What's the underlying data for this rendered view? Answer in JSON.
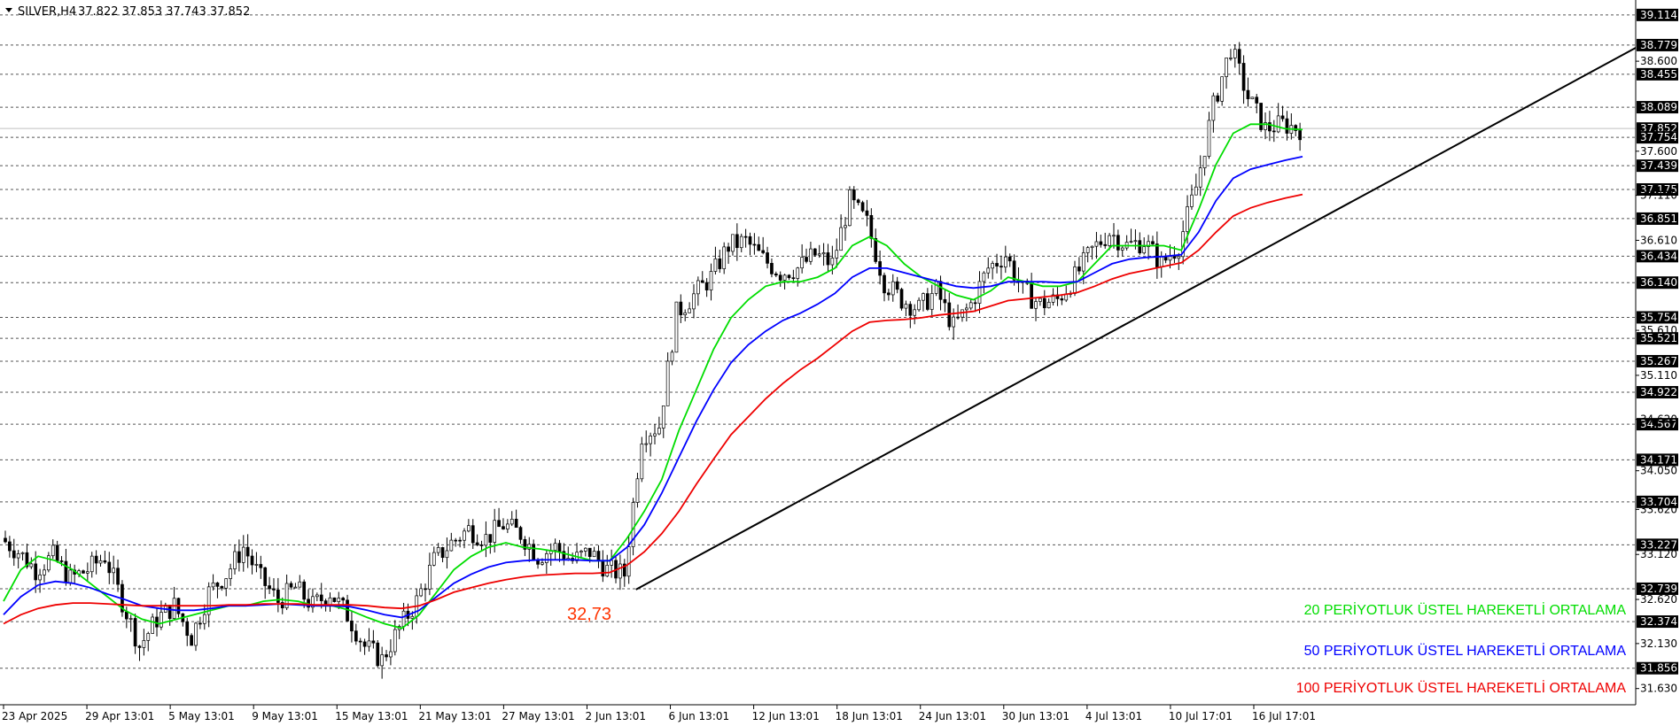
{
  "header": {
    "symbol": "SILVER,H4",
    "ohlc": "37.822 37.853 37.743 37.852"
  },
  "chart_data": {
    "type": "candlestick",
    "symbol": "SILVER",
    "timeframe": "H4",
    "ylim": [
      31.45,
      39.28
    ],
    "x_tick_labels": [
      "23 Apr 2025",
      "29 Apr 13:01",
      "5 May 13:01",
      "9 May 13:01",
      "15 May 13:01",
      "21 May 13:01",
      "27 May 13:01",
      "2 Jun 13:01",
      "6 Jun 13:01",
      "12 Jun 13:01",
      "18 Jun 13:01",
      "24 Jun 13:01",
      "30 Jun 13:01",
      "4 Jul 13:01",
      "10 Jul 17:01",
      "16 Jul 17:01"
    ],
    "y_tick_labels": [
      "38.600",
      "37.600",
      "36.610",
      "35.610",
      "35.110",
      "34.620",
      "34.050",
      "33.620",
      "33.120",
      "32.620",
      "32.130",
      "31.630",
      "37.110"
    ],
    "levels": [
      "39.114",
      "38.779",
      "38.455",
      "38.089",
      "37.852",
      "37.754",
      "37.439",
      "37.175",
      "36.851",
      "36.434",
      "36.140",
      "35.754",
      "35.521",
      "35.267",
      "34.922",
      "34.567",
      "34.171",
      "33.704",
      "33.227",
      "32.739",
      "32.374",
      "31.856"
    ],
    "current_price": "37.852",
    "close": [
      33.3,
      33.15,
      32.95,
      33.1,
      32.85,
      32.95,
      33.1,
      32.6,
      32.1,
      32.4,
      32.55,
      32.2,
      32.7,
      32.9,
      33.2,
      32.85,
      32.6,
      32.75,
      32.55,
      32.7,
      32.45,
      32.1,
      31.95,
      32.3,
      32.6,
      33.05,
      33.25,
      33.4,
      33.3,
      33.45,
      33.35,
      33.1,
      33.2,
      33.05,
      33.15,
      32.95,
      32.9,
      34.45,
      34.55,
      35.8,
      36.0,
      36.2,
      36.55,
      36.6,
      36.4,
      36.25,
      36.3,
      36.45,
      36.35,
      37.05,
      36.8,
      36.15,
      35.95,
      35.85,
      36.05,
      35.65,
      35.9,
      36.3,
      36.45,
      36.05,
      35.9,
      35.95,
      36.2,
      36.5,
      36.7,
      36.55,
      36.6,
      36.35,
      36.55,
      37.2,
      38.1,
      38.75,
      38.2,
      37.85,
      37.9,
      37.85
    ],
    "series": [
      {
        "name": "20 PERİYOTLUK ÜSTEL HAREKETLİ ORTALAMA",
        "color": "#00dd00",
        "values": [
          32.6,
          32.95,
          33.1,
          33.05,
          32.95,
          32.8,
          32.65,
          32.5,
          32.4,
          32.35,
          32.4,
          32.45,
          32.5,
          32.55,
          32.55,
          32.6,
          32.62,
          32.6,
          32.55,
          32.55,
          32.5,
          32.42,
          32.35,
          32.3,
          32.45,
          32.7,
          32.95,
          33.1,
          33.2,
          33.25,
          33.2,
          33.18,
          33.15,
          33.1,
          33.05,
          33.05,
          33.3,
          33.6,
          33.95,
          34.5,
          34.95,
          35.4,
          35.75,
          35.95,
          36.1,
          36.15,
          36.15,
          36.2,
          36.3,
          36.55,
          36.65,
          36.55,
          36.35,
          36.2,
          36.1,
          36.0,
          35.95,
          36.05,
          36.2,
          36.15,
          36.1,
          36.1,
          36.15,
          36.35,
          36.55,
          36.55,
          36.55,
          36.55,
          36.5,
          36.95,
          37.45,
          37.8,
          37.9,
          37.9,
          37.85,
          37.84
        ]
      },
      {
        "name": "50 PERİYOTLUK ÜSTEL HAREKETLİ ORTALAMA",
        "color": "#0000ff",
        "values": [
          32.45,
          32.65,
          32.78,
          32.82,
          32.8,
          32.75,
          32.68,
          32.62,
          32.55,
          32.52,
          32.5,
          32.5,
          32.52,
          32.55,
          32.55,
          32.56,
          32.57,
          32.56,
          32.55,
          32.55,
          32.54,
          32.5,
          32.45,
          32.42,
          32.5,
          32.65,
          32.8,
          32.9,
          32.98,
          33.03,
          33.05,
          33.06,
          33.06,
          33.06,
          33.05,
          33.05,
          33.2,
          33.45,
          33.8,
          34.2,
          34.6,
          34.95,
          35.25,
          35.45,
          35.6,
          35.72,
          35.8,
          35.9,
          36.02,
          36.2,
          36.3,
          36.3,
          36.25,
          36.2,
          36.15,
          36.1,
          36.08,
          36.1,
          36.15,
          36.15,
          36.15,
          36.14,
          36.15,
          36.25,
          36.35,
          36.4,
          36.42,
          36.43,
          36.45,
          36.7,
          37.05,
          37.3,
          37.4,
          37.45,
          37.5,
          37.54
        ]
      },
      {
        "name": "100 PERİYOTLUK ÜSTEL HAREKETLİ ORTALAMA",
        "color": "#ee0000",
        "values": [
          32.35,
          32.45,
          32.52,
          32.56,
          32.58,
          32.58,
          32.57,
          32.56,
          32.55,
          32.55,
          32.55,
          32.55,
          32.55,
          32.56,
          32.56,
          32.57,
          32.57,
          32.57,
          32.56,
          32.56,
          32.56,
          32.55,
          32.53,
          32.52,
          32.55,
          32.62,
          32.7,
          32.75,
          32.8,
          32.84,
          32.87,
          32.89,
          32.9,
          32.91,
          32.91,
          32.92,
          33.0,
          33.15,
          33.35,
          33.6,
          33.9,
          34.18,
          34.45,
          34.65,
          34.85,
          35.02,
          35.17,
          35.3,
          35.45,
          35.6,
          35.7,
          35.72,
          35.73,
          35.75,
          35.78,
          35.8,
          35.82,
          35.88,
          35.94,
          35.96,
          35.98,
          36.0,
          36.03,
          36.1,
          36.18,
          36.24,
          36.28,
          36.32,
          36.36,
          36.5,
          36.7,
          36.88,
          36.97,
          37.03,
          37.08,
          37.12
        ]
      }
    ],
    "annotations": [
      "32,73"
    ],
    "trendline": {
      "from_label": "32,73",
      "from_value": 32.73,
      "color": "#000000"
    }
  },
  "legend": [
    {
      "label": "20 PERİYOTLUK ÜSTEL HAREKETLİ ORTALAMA",
      "color": "#00dd00"
    },
    {
      "label": "50 PERİYOTLUK ÜSTEL HAREKETLİ ORTALAMA",
      "color": "#0000ff"
    },
    {
      "label": "100 PERİYOTLUK ÜSTEL HAREKETLİ ORTALAMA",
      "color": "#ee0000"
    }
  ],
  "colors": {
    "grid": "#555555",
    "candle": "#000000",
    "annotation": "#ff3300",
    "label_bg": "#000000",
    "label_fg": "#ffffff"
  }
}
